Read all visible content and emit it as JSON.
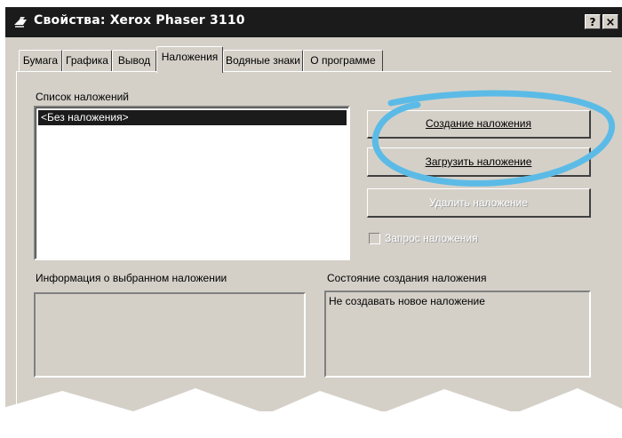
{
  "window": {
    "title": "Свойства: Xerox Phaser 3110",
    "help_label": "?",
    "close_label": "×"
  },
  "tabs": [
    {
      "label": "Бумага",
      "active": false
    },
    {
      "label": "Графика",
      "active": false
    },
    {
      "label": "Вывод",
      "active": false
    },
    {
      "label": "Наложения",
      "active": true
    },
    {
      "label": "Водяные знаки",
      "active": false
    },
    {
      "label": "О программе",
      "active": false
    }
  ],
  "overlay_list": {
    "label": "Список наложений",
    "items": [
      "<Без наложения>"
    ],
    "selected_index": 0
  },
  "buttons": {
    "create": "Создание наложения",
    "load": "Загрузить наложение",
    "delete": "Удалить наложение"
  },
  "confirm_checkbox": {
    "label": "Запрос наложения",
    "checked": false,
    "enabled": false
  },
  "info_group": {
    "label": "Информация о выбранном наложении",
    "text": ""
  },
  "status_group": {
    "label": "Состояние создания наложения",
    "text": "Не создавать новое наложение"
  },
  "colors": {
    "title_bar": "#1b1b1b",
    "dialog_face": "#d4d0c8",
    "highlight_ring": "#5bbbe6"
  }
}
